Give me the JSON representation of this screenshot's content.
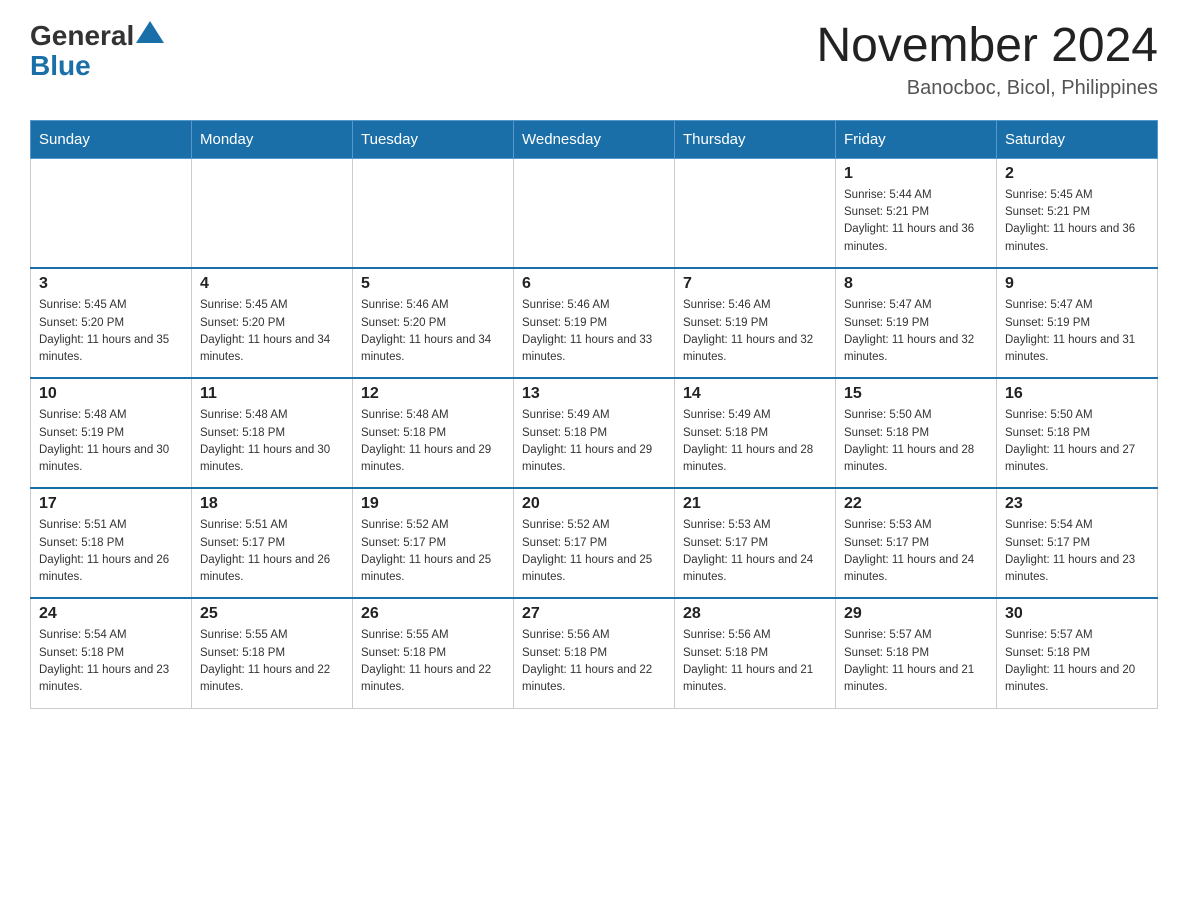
{
  "logo": {
    "general": "General",
    "blue": "Blue"
  },
  "title": "November 2024",
  "subtitle": "Banocboc, Bicol, Philippines",
  "days_of_week": [
    "Sunday",
    "Monday",
    "Tuesday",
    "Wednesday",
    "Thursday",
    "Friday",
    "Saturday"
  ],
  "weeks": [
    {
      "days": [
        {
          "number": "",
          "info": ""
        },
        {
          "number": "",
          "info": ""
        },
        {
          "number": "",
          "info": ""
        },
        {
          "number": "",
          "info": ""
        },
        {
          "number": "",
          "info": ""
        },
        {
          "number": "1",
          "info": "Sunrise: 5:44 AM\nSunset: 5:21 PM\nDaylight: 11 hours and 36 minutes."
        },
        {
          "number": "2",
          "info": "Sunrise: 5:45 AM\nSunset: 5:21 PM\nDaylight: 11 hours and 36 minutes."
        }
      ]
    },
    {
      "days": [
        {
          "number": "3",
          "info": "Sunrise: 5:45 AM\nSunset: 5:20 PM\nDaylight: 11 hours and 35 minutes."
        },
        {
          "number": "4",
          "info": "Sunrise: 5:45 AM\nSunset: 5:20 PM\nDaylight: 11 hours and 34 minutes."
        },
        {
          "number": "5",
          "info": "Sunrise: 5:46 AM\nSunset: 5:20 PM\nDaylight: 11 hours and 34 minutes."
        },
        {
          "number": "6",
          "info": "Sunrise: 5:46 AM\nSunset: 5:19 PM\nDaylight: 11 hours and 33 minutes."
        },
        {
          "number": "7",
          "info": "Sunrise: 5:46 AM\nSunset: 5:19 PM\nDaylight: 11 hours and 32 minutes."
        },
        {
          "number": "8",
          "info": "Sunrise: 5:47 AM\nSunset: 5:19 PM\nDaylight: 11 hours and 32 minutes."
        },
        {
          "number": "9",
          "info": "Sunrise: 5:47 AM\nSunset: 5:19 PM\nDaylight: 11 hours and 31 minutes."
        }
      ]
    },
    {
      "days": [
        {
          "number": "10",
          "info": "Sunrise: 5:48 AM\nSunset: 5:19 PM\nDaylight: 11 hours and 30 minutes."
        },
        {
          "number": "11",
          "info": "Sunrise: 5:48 AM\nSunset: 5:18 PM\nDaylight: 11 hours and 30 minutes."
        },
        {
          "number": "12",
          "info": "Sunrise: 5:48 AM\nSunset: 5:18 PM\nDaylight: 11 hours and 29 minutes."
        },
        {
          "number": "13",
          "info": "Sunrise: 5:49 AM\nSunset: 5:18 PM\nDaylight: 11 hours and 29 minutes."
        },
        {
          "number": "14",
          "info": "Sunrise: 5:49 AM\nSunset: 5:18 PM\nDaylight: 11 hours and 28 minutes."
        },
        {
          "number": "15",
          "info": "Sunrise: 5:50 AM\nSunset: 5:18 PM\nDaylight: 11 hours and 28 minutes."
        },
        {
          "number": "16",
          "info": "Sunrise: 5:50 AM\nSunset: 5:18 PM\nDaylight: 11 hours and 27 minutes."
        }
      ]
    },
    {
      "days": [
        {
          "number": "17",
          "info": "Sunrise: 5:51 AM\nSunset: 5:18 PM\nDaylight: 11 hours and 26 minutes."
        },
        {
          "number": "18",
          "info": "Sunrise: 5:51 AM\nSunset: 5:17 PM\nDaylight: 11 hours and 26 minutes."
        },
        {
          "number": "19",
          "info": "Sunrise: 5:52 AM\nSunset: 5:17 PM\nDaylight: 11 hours and 25 minutes."
        },
        {
          "number": "20",
          "info": "Sunrise: 5:52 AM\nSunset: 5:17 PM\nDaylight: 11 hours and 25 minutes."
        },
        {
          "number": "21",
          "info": "Sunrise: 5:53 AM\nSunset: 5:17 PM\nDaylight: 11 hours and 24 minutes."
        },
        {
          "number": "22",
          "info": "Sunrise: 5:53 AM\nSunset: 5:17 PM\nDaylight: 11 hours and 24 minutes."
        },
        {
          "number": "23",
          "info": "Sunrise: 5:54 AM\nSunset: 5:17 PM\nDaylight: 11 hours and 23 minutes."
        }
      ]
    },
    {
      "days": [
        {
          "number": "24",
          "info": "Sunrise: 5:54 AM\nSunset: 5:18 PM\nDaylight: 11 hours and 23 minutes."
        },
        {
          "number": "25",
          "info": "Sunrise: 5:55 AM\nSunset: 5:18 PM\nDaylight: 11 hours and 22 minutes."
        },
        {
          "number": "26",
          "info": "Sunrise: 5:55 AM\nSunset: 5:18 PM\nDaylight: 11 hours and 22 minutes."
        },
        {
          "number": "27",
          "info": "Sunrise: 5:56 AM\nSunset: 5:18 PM\nDaylight: 11 hours and 22 minutes."
        },
        {
          "number": "28",
          "info": "Sunrise: 5:56 AM\nSunset: 5:18 PM\nDaylight: 11 hours and 21 minutes."
        },
        {
          "number": "29",
          "info": "Sunrise: 5:57 AM\nSunset: 5:18 PM\nDaylight: 11 hours and 21 minutes."
        },
        {
          "number": "30",
          "info": "Sunrise: 5:57 AM\nSunset: 5:18 PM\nDaylight: 11 hours and 20 minutes."
        }
      ]
    }
  ]
}
